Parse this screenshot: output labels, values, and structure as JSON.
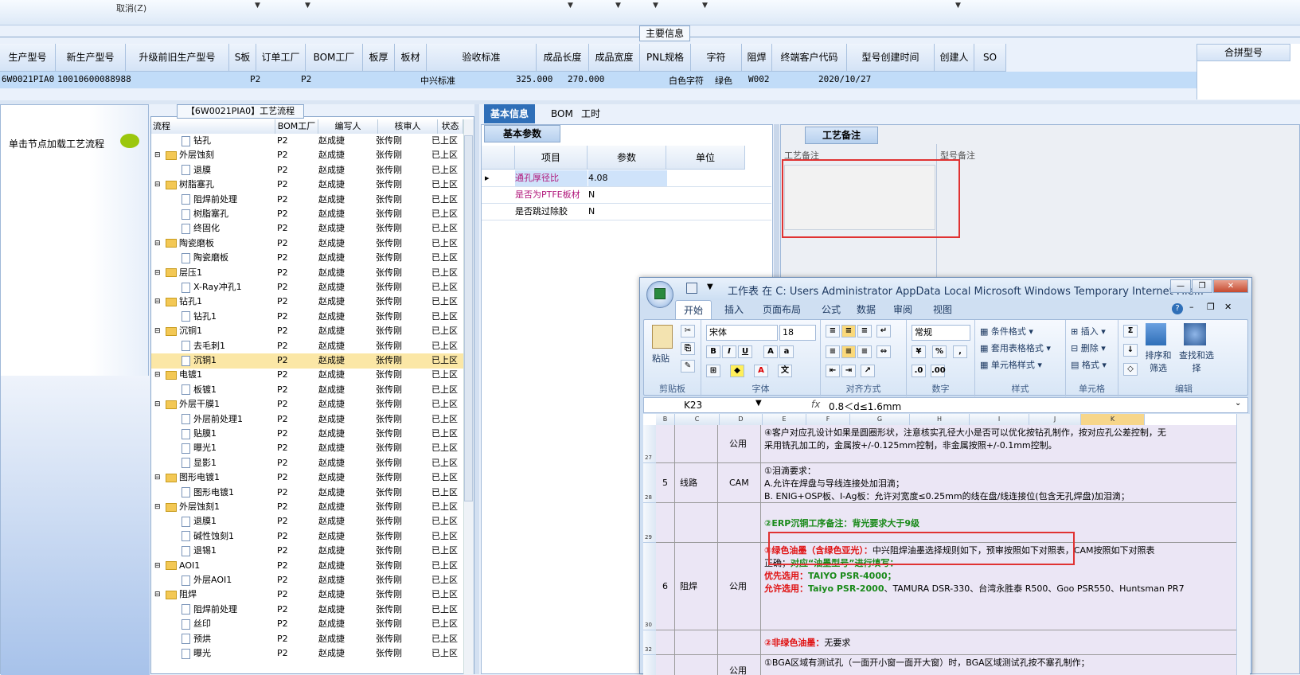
{
  "toolbar": {
    "cancel": "取消(Z)"
  },
  "main_info": {
    "section_title": "主要信息",
    "headers": [
      "生产型号",
      "新生产型号",
      "升级前旧生产型号",
      "S板",
      "订单工厂",
      "BOM工厂",
      "板厚",
      "板材",
      "验收标准",
      "成品长度",
      "成品宽度",
      "PNL规格",
      "字符",
      "阻焊",
      "终端客户代码",
      "型号创建时间",
      "创建人",
      "SO"
    ],
    "row": {
      "prod_model": "6W0021PIA0",
      "new_model": "10010600088988",
      "order_factory": "P2",
      "bom_factory": "P2",
      "standard": "中兴标准",
      "length": "325.000",
      "width": "270.000",
      "char": "白色字符",
      "mask": "绿色",
      "customer": "W002",
      "created": "2020/10/27"
    },
    "merge_header": "合拼型号"
  },
  "left_nav": {
    "load_label": "单击节点加载工艺流程"
  },
  "flow": {
    "title": "【6W0021PIA0】工艺流程",
    "columns": [
      "流程",
      "BOM工厂",
      "编写人",
      "核审人",
      "状态"
    ],
    "rows": [
      {
        "name": "钻孔",
        "level": 1,
        "factory": "P2",
        "writer": "赵成捷",
        "checker": "张传刚",
        "status": "已上区"
      },
      {
        "name": "外层蚀刻",
        "level": 0,
        "factory": "P2",
        "writer": "赵成捷",
        "checker": "张传刚",
        "status": "已上区"
      },
      {
        "name": "退膜",
        "level": 1,
        "factory": "P2",
        "writer": "赵成捷",
        "checker": "张传刚",
        "status": "已上区"
      },
      {
        "name": "树脂塞孔",
        "level": 0,
        "factory": "P2",
        "writer": "赵成捷",
        "checker": "张传刚",
        "status": "已上区"
      },
      {
        "name": "阻焊前处理",
        "level": 1,
        "factory": "P2",
        "writer": "赵成捷",
        "checker": "张传刚",
        "status": "已上区"
      },
      {
        "name": "树脂塞孔",
        "level": 1,
        "factory": "P2",
        "writer": "赵成捷",
        "checker": "张传刚",
        "status": "已上区"
      },
      {
        "name": "终固化",
        "level": 1,
        "factory": "P2",
        "writer": "赵成捷",
        "checker": "张传刚",
        "status": "已上区"
      },
      {
        "name": "陶瓷磨板",
        "level": 0,
        "factory": "P2",
        "writer": "赵成捷",
        "checker": "张传刚",
        "status": "已上区"
      },
      {
        "name": "陶瓷磨板",
        "level": 1,
        "factory": "P2",
        "writer": "赵成捷",
        "checker": "张传刚",
        "status": "已上区"
      },
      {
        "name": "层压1",
        "level": 0,
        "factory": "P2",
        "writer": "赵成捷",
        "checker": "张传刚",
        "status": "已上区"
      },
      {
        "name": "X-Ray冲孔1",
        "level": 1,
        "factory": "P2",
        "writer": "赵成捷",
        "checker": "张传刚",
        "status": "已上区"
      },
      {
        "name": "钻孔1",
        "level": 0,
        "factory": "P2",
        "writer": "赵成捷",
        "checker": "张传刚",
        "status": "已上区"
      },
      {
        "name": "钻孔1",
        "level": 1,
        "factory": "P2",
        "writer": "赵成捷",
        "checker": "张传刚",
        "status": "已上区"
      },
      {
        "name": "沉铜1",
        "level": 0,
        "factory": "P2",
        "writer": "赵成捷",
        "checker": "张传刚",
        "status": "已上区"
      },
      {
        "name": "去毛刺1",
        "level": 1,
        "factory": "P2",
        "writer": "赵成捷",
        "checker": "张传刚",
        "status": "已上区"
      },
      {
        "name": "沉铜1",
        "level": 1,
        "factory": "P2",
        "writer": "赵成捷",
        "checker": "张传刚",
        "status": "已上区",
        "selected": true
      },
      {
        "name": "电镀1",
        "level": 0,
        "factory": "P2",
        "writer": "赵成捷",
        "checker": "张传刚",
        "status": "已上区"
      },
      {
        "name": "板镀1",
        "level": 1,
        "factory": "P2",
        "writer": "赵成捷",
        "checker": "张传刚",
        "status": "已上区"
      },
      {
        "name": "外层干膜1",
        "level": 0,
        "factory": "P2",
        "writer": "赵成捷",
        "checker": "张传刚",
        "status": "已上区"
      },
      {
        "name": "外层前处理1",
        "level": 1,
        "factory": "P2",
        "writer": "赵成捷",
        "checker": "张传刚",
        "status": "已上区"
      },
      {
        "name": "贴膜1",
        "level": 1,
        "factory": "P2",
        "writer": "赵成捷",
        "checker": "张传刚",
        "status": "已上区"
      },
      {
        "name": "曝光1",
        "level": 1,
        "factory": "P2",
        "writer": "赵成捷",
        "checker": "张传刚",
        "status": "已上区"
      },
      {
        "name": "显影1",
        "level": 1,
        "factory": "P2",
        "writer": "赵成捷",
        "checker": "张传刚",
        "status": "已上区"
      },
      {
        "name": "图形电镀1",
        "level": 0,
        "factory": "P2",
        "writer": "赵成捷",
        "checker": "张传刚",
        "status": "已上区"
      },
      {
        "name": "图形电镀1",
        "level": 1,
        "factory": "P2",
        "writer": "赵成捷",
        "checker": "张传刚",
        "status": "已上区"
      },
      {
        "name": "外层蚀刻1",
        "level": 0,
        "factory": "P2",
        "writer": "赵成捷",
        "checker": "张传刚",
        "status": "已上区"
      },
      {
        "name": "退膜1",
        "level": 1,
        "factory": "P2",
        "writer": "赵成捷",
        "checker": "张传刚",
        "status": "已上区"
      },
      {
        "name": "碱性蚀刻1",
        "level": 1,
        "factory": "P2",
        "writer": "赵成捷",
        "checker": "张传刚",
        "status": "已上区"
      },
      {
        "name": "退锡1",
        "level": 1,
        "factory": "P2",
        "writer": "赵成捷",
        "checker": "张传刚",
        "status": "已上区"
      },
      {
        "name": "AOI1",
        "level": 0,
        "factory": "P2",
        "writer": "赵成捷",
        "checker": "张传刚",
        "status": "已上区"
      },
      {
        "name": "外层AOI1",
        "level": 1,
        "factory": "P2",
        "writer": "赵成捷",
        "checker": "张传刚",
        "status": "已上区"
      },
      {
        "name": "阻焊",
        "level": 0,
        "factory": "P2",
        "writer": "赵成捷",
        "checker": "张传刚",
        "status": "已上区"
      },
      {
        "name": "阻焊前处理",
        "level": 1,
        "factory": "P2",
        "writer": "赵成捷",
        "checker": "张传刚",
        "status": "已上区"
      },
      {
        "name": "丝印",
        "level": 1,
        "factory": "P2",
        "writer": "赵成捷",
        "checker": "张传刚",
        "status": "已上区"
      },
      {
        "name": "预烘",
        "level": 1,
        "factory": "P2",
        "writer": "赵成捷",
        "checker": "张传刚",
        "status": "已上区"
      },
      {
        "name": "曝光",
        "level": 1,
        "factory": "P2",
        "writer": "赵成捷",
        "checker": "张传刚",
        "status": "已上区"
      }
    ]
  },
  "detail_tabs": [
    "基本信息",
    "BOM",
    "工时"
  ],
  "basic_params": {
    "subtab": "基本参数",
    "columns": [
      "项目",
      "参数",
      "单位"
    ],
    "rows": [
      {
        "item": "通孔厚径比",
        "value": "4.08",
        "unit": ""
      },
      {
        "item": "是否为PTFE板材",
        "value": "N",
        "unit": ""
      },
      {
        "item": "是否跳过除胶",
        "value": "N",
        "unit": ""
      }
    ]
  },
  "process_note": {
    "tab": "工艺备注",
    "col1": "工艺备注",
    "col2": "型号备注"
  },
  "excel": {
    "title": "工作表 在 C: Users Administrator AppData Local Microsoft Windows Temporary Internet File...",
    "tabs": [
      "开始",
      "插入",
      "页面布局",
      "公式",
      "数据",
      "审阅",
      "视图"
    ],
    "groups": [
      "剪贴板",
      "字体",
      "对齐方式",
      "数字",
      "样式",
      "单元格",
      "编辑"
    ],
    "font_name": "宋体",
    "font_size": "18",
    "number_format": "常规",
    "paste": "粘贴",
    "styles": [
      "条件格式",
      "套用表格格式",
      "单元格样式"
    ],
    "cells": [
      "插入",
      "删除",
      "格式"
    ],
    "edit": [
      "排序和筛选",
      "查找和选择"
    ],
    "name_box": "K23",
    "formula": "0.8＜d≤1.6mm",
    "col_letters": [
      "B",
      "C",
      "D",
      "E",
      "F",
      "G",
      "H",
      "I",
      "J",
      "K"
    ],
    "rows": [
      {
        "rownum": "27",
        "no": "",
        "proc": "",
        "dept": "公用",
        "lines": [
          "④客户对应孔设计如果是圆圈形状，注意核实孔径大小是否可以优化按钻孔制作，按对应孔公差控制，无",
          "采用铣孔加工的，金属按+/-0.125mm控制，非金属按照+/-0.1mm控制。"
        ]
      },
      {
        "rownum": "28",
        "no": "5",
        "proc": "线路",
        "dept": "CAM",
        "lines": [
          "①泪滴要求：",
          "A.允许在焊盘与导线连接处加泪滴；",
          "B. ENIG+OSP板、I-Ag板：允许对宽度≤0.25mm的线在盘/线连接位(包含无孔焊盘)加泪滴；"
        ]
      },
      {
        "rownum": "29",
        "no": "",
        "proc": "",
        "dept": "",
        "lines": [
          "②ERP沉铜工序备注：背光要求大于9级"
        ]
      },
      {
        "rownum": "30",
        "no": "6",
        "proc": "阻焊",
        "dept": "公用",
        "lines": [
          "①绿色油墨（含绿色亚光）：",
          "中兴阻焊油墨选择规则如下，预审按照如下对照表，CAM按照如下对照表",
          "正确；",
          "对应“油墨型号”进行填写：",
          "优先选用：",
          "TAIYO PSR-4000；",
          "允许选用：",
          "Taiyo PSR-2000",
          "、TAMURA DSR-330、台湾永胜泰 R500、Goo PSR550、Huntsman PR7"
        ]
      },
      {
        "rownum": "32",
        "no": "",
        "proc": "",
        "dept": "",
        "lines": [
          "②非绿色油墨：",
          "无要求"
        ]
      },
      {
        "rownum": "",
        "no": "",
        "proc": "",
        "dept": "公用",
        "lines": [
          "①BGA区域有测试孔（一面开小窗一面开大窗）时，BGA区域测试孔按不塞孔制作；"
        ]
      }
    ]
  }
}
